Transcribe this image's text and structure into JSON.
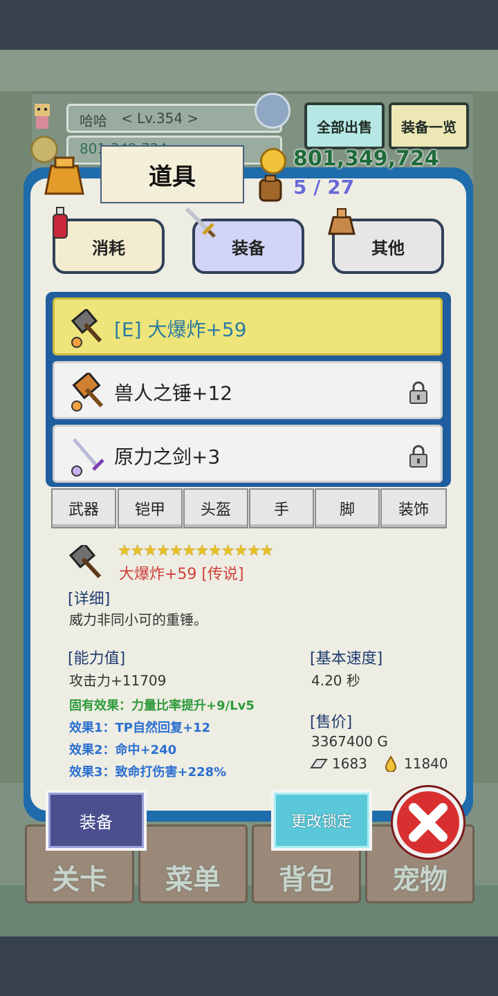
{
  "hud": {
    "player_name": "哈哈",
    "level": "< Lv.354 >",
    "gold_partial": "801,349,724",
    "sell_all_label": "全部出售",
    "equip_list_label": "装备一览",
    "gold": "801,349,724",
    "bag_capacity": "5 / 27"
  },
  "panel": {
    "title": "道具",
    "category_tabs": [
      "消耗",
      "装备",
      "其他"
    ],
    "selected_category": "装备"
  },
  "items": [
    {
      "name": "[E] 大爆炸+59",
      "equipped": true,
      "locked": false
    },
    {
      "name": "兽人之锤+12",
      "equipped": false,
      "locked": true
    },
    {
      "name": "原力之剑+3",
      "equipped": false,
      "locked": true
    }
  ],
  "type_tabs": [
    "武器",
    "铠甲",
    "头盔",
    "手",
    "脚",
    "装饰"
  ],
  "detail": {
    "stars": "★★★★★★★★★★★★",
    "star_count": 12,
    "item_name": "大爆炸+59 [传说]",
    "detail_label": "[详细]",
    "description": "威力非同小可的重锤。",
    "stats_label": "[能力值]",
    "attack": "攻击力+11709",
    "innate": "固有效果：力量比率提升+9/Lv5",
    "effect1": "效果1：TP自然回复+12",
    "effect2": "效果2：命中+240",
    "effect3": "效果3：致命打伤害+228%",
    "speed_label": "[基本速度]",
    "speed": "4.20 秒",
    "price_label": "[售价]",
    "price": "3367400 G",
    "material_silver": "1683",
    "material_gold": "11840"
  },
  "buttons": {
    "equip": "装备",
    "change_lock": "更改锁定"
  },
  "bottom_nav": [
    "关卡",
    "菜单",
    "背包",
    "宠物"
  ],
  "colors": {
    "panel_blue": "#1e6cac",
    "selected_row": "#ede47a",
    "legendary_red": "#d0403a",
    "innate_green": "#2e9a3a",
    "effect_blue": "#2a6fd0",
    "gold_text": "#1e6b3a",
    "bag_text": "#6a6ad8"
  }
}
